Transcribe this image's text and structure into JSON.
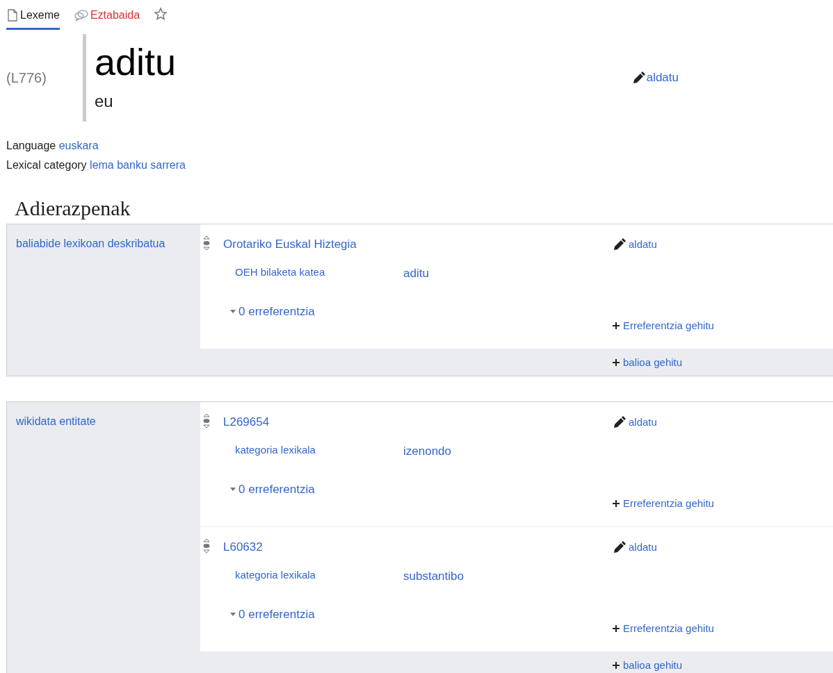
{
  "tabs": [
    {
      "label": "Lexeme",
      "kind": "page",
      "selected": true,
      "missing": false
    },
    {
      "label": "Eztabaida",
      "kind": "talk",
      "selected": false,
      "missing": true
    }
  ],
  "header": {
    "id": "(L776)",
    "lemma": "aditu",
    "lemma_language": "eu",
    "edit": "aldatu"
  },
  "properties": [
    {
      "label": "Language",
      "value": "euskara"
    },
    {
      "label": "Lexical category",
      "value": "lema banku sarrera"
    }
  ],
  "section_title": "Adierazpenak",
  "statement_groups": [
    {
      "property": "baliabide lexikoan deskribatua",
      "add_value": "balioa gehitu",
      "statements": [
        {
          "value": "Orotariko Euskal Hiztegia",
          "edit": "aldatu",
          "qualifiers": [
            {
              "property": "OEH bilaketa katea",
              "value": "aditu"
            }
          ],
          "references": "0 erreferentzia",
          "add_reference": "Erreferentzia gehitu"
        }
      ]
    },
    {
      "property": "wikidata entitate",
      "add_value": "balioa gehitu",
      "statements": [
        {
          "value": "L269654",
          "edit": "aldatu",
          "qualifiers": [
            {
              "property": "kategoria lexikala",
              "value": "izenondo"
            }
          ],
          "references": "0 erreferentzia",
          "add_reference": "Erreferentzia gehitu"
        },
        {
          "value": "L60632",
          "edit": "aldatu",
          "qualifiers": [
            {
              "property": "kategoria lexikala",
              "value": "substantibo"
            }
          ],
          "references": "0 erreferentzia",
          "add_reference": "Erreferentzia gehitu"
        }
      ]
    }
  ]
}
